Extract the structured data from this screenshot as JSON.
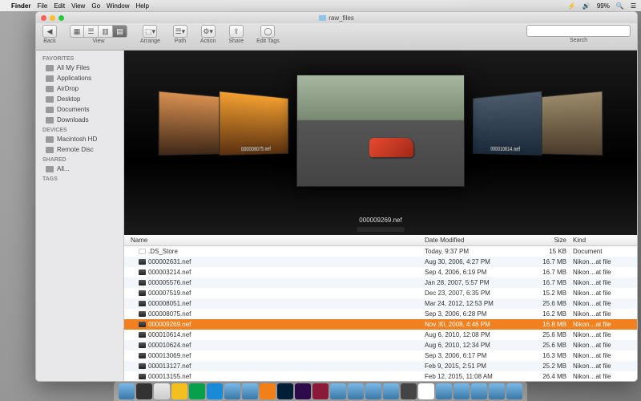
{
  "menubar": {
    "app": "Finder",
    "items": [
      "File",
      "Edit",
      "View",
      "Go",
      "Window",
      "Help"
    ],
    "right": {
      "battery": "99%",
      "time": ""
    }
  },
  "window": {
    "title": "raw_files"
  },
  "toolbar": {
    "back": "Back",
    "view": "View",
    "arrange": "Arrange",
    "path": "Path",
    "action": "Action",
    "share": "Share",
    "edit_tags": "Edit Tags",
    "search": "Search",
    "search_placeholder": ""
  },
  "sidebar": {
    "sections": [
      {
        "header": "Favorites",
        "items": [
          "All My Files",
          "Applications",
          "AirDrop",
          "Desktop",
          "Documents",
          "Downloads"
        ]
      },
      {
        "header": "Devices",
        "items": [
          "Macintosh HD",
          "Remote Disc"
        ]
      },
      {
        "header": "Shared",
        "items": [
          "All..."
        ]
      },
      {
        "header": "Tags",
        "items": []
      }
    ]
  },
  "coverflow": {
    "center_caption": "000009269.nef",
    "neighbors_left": [
      "000008075.nef"
    ],
    "neighbors_right": [
      "000010614.nef"
    ]
  },
  "columns": {
    "name": "Name",
    "date": "Date Modified",
    "size": "Size",
    "kind": "Kind"
  },
  "rows": [
    {
      "name": ".DS_Store",
      "date": "Today, 9:37 PM",
      "size": "15 KB",
      "kind": "Document",
      "sel": false,
      "doc": true
    },
    {
      "name": "000002631.nef",
      "date": "Aug 30, 2006, 4:27 PM",
      "size": "16.7 MB",
      "kind": "Nikon…at file",
      "sel": false
    },
    {
      "name": "000003214.nef",
      "date": "Sep 4, 2006, 6:19 PM",
      "size": "16.7 MB",
      "kind": "Nikon…at file",
      "sel": false
    },
    {
      "name": "000005576.nef",
      "date": "Jan 28, 2007, 5:57 PM",
      "size": "16.7 MB",
      "kind": "Nikon…at file",
      "sel": false
    },
    {
      "name": "000007519.nef",
      "date": "Dec 23, 2007, 6:35 PM",
      "size": "15.2 MB",
      "kind": "Nikon…at file",
      "sel": false
    },
    {
      "name": "000008051.nef",
      "date": "Mar 24, 2012, 12:53 PM",
      "size": "25.6 MB",
      "kind": "Nikon…at file",
      "sel": false
    },
    {
      "name": "000008075.nef",
      "date": "Sep 3, 2006, 6:28 PM",
      "size": "16.2 MB",
      "kind": "Nikon…at file",
      "sel": false
    },
    {
      "name": "000009269.nef",
      "date": "Nov 30, 2008, 4:46 PM",
      "size": "16.8 MB",
      "kind": "Nikon…at file",
      "sel": true
    },
    {
      "name": "000010614.nef",
      "date": "Aug 6, 2010, 12:08 PM",
      "size": "25.6 MB",
      "kind": "Nikon…at file",
      "sel": false
    },
    {
      "name": "000010624.nef",
      "date": "Aug 6, 2010, 12:34 PM",
      "size": "25.6 MB",
      "kind": "Nikon…at file",
      "sel": false
    },
    {
      "name": "000013069.nef",
      "date": "Sep 3, 2006, 6:17 PM",
      "size": "16.3 MB",
      "kind": "Nikon…at file",
      "sel": false
    },
    {
      "name": "000013127.nef",
      "date": "Feb 9, 2015, 2:51 PM",
      "size": "25.2 MB",
      "kind": "Nikon…at file",
      "sel": false
    },
    {
      "name": "000013155.nef",
      "date": "Feb 12, 2015, 11:08 AM",
      "size": "26.4 MB",
      "kind": "Nikon…at file",
      "sel": false
    }
  ]
}
